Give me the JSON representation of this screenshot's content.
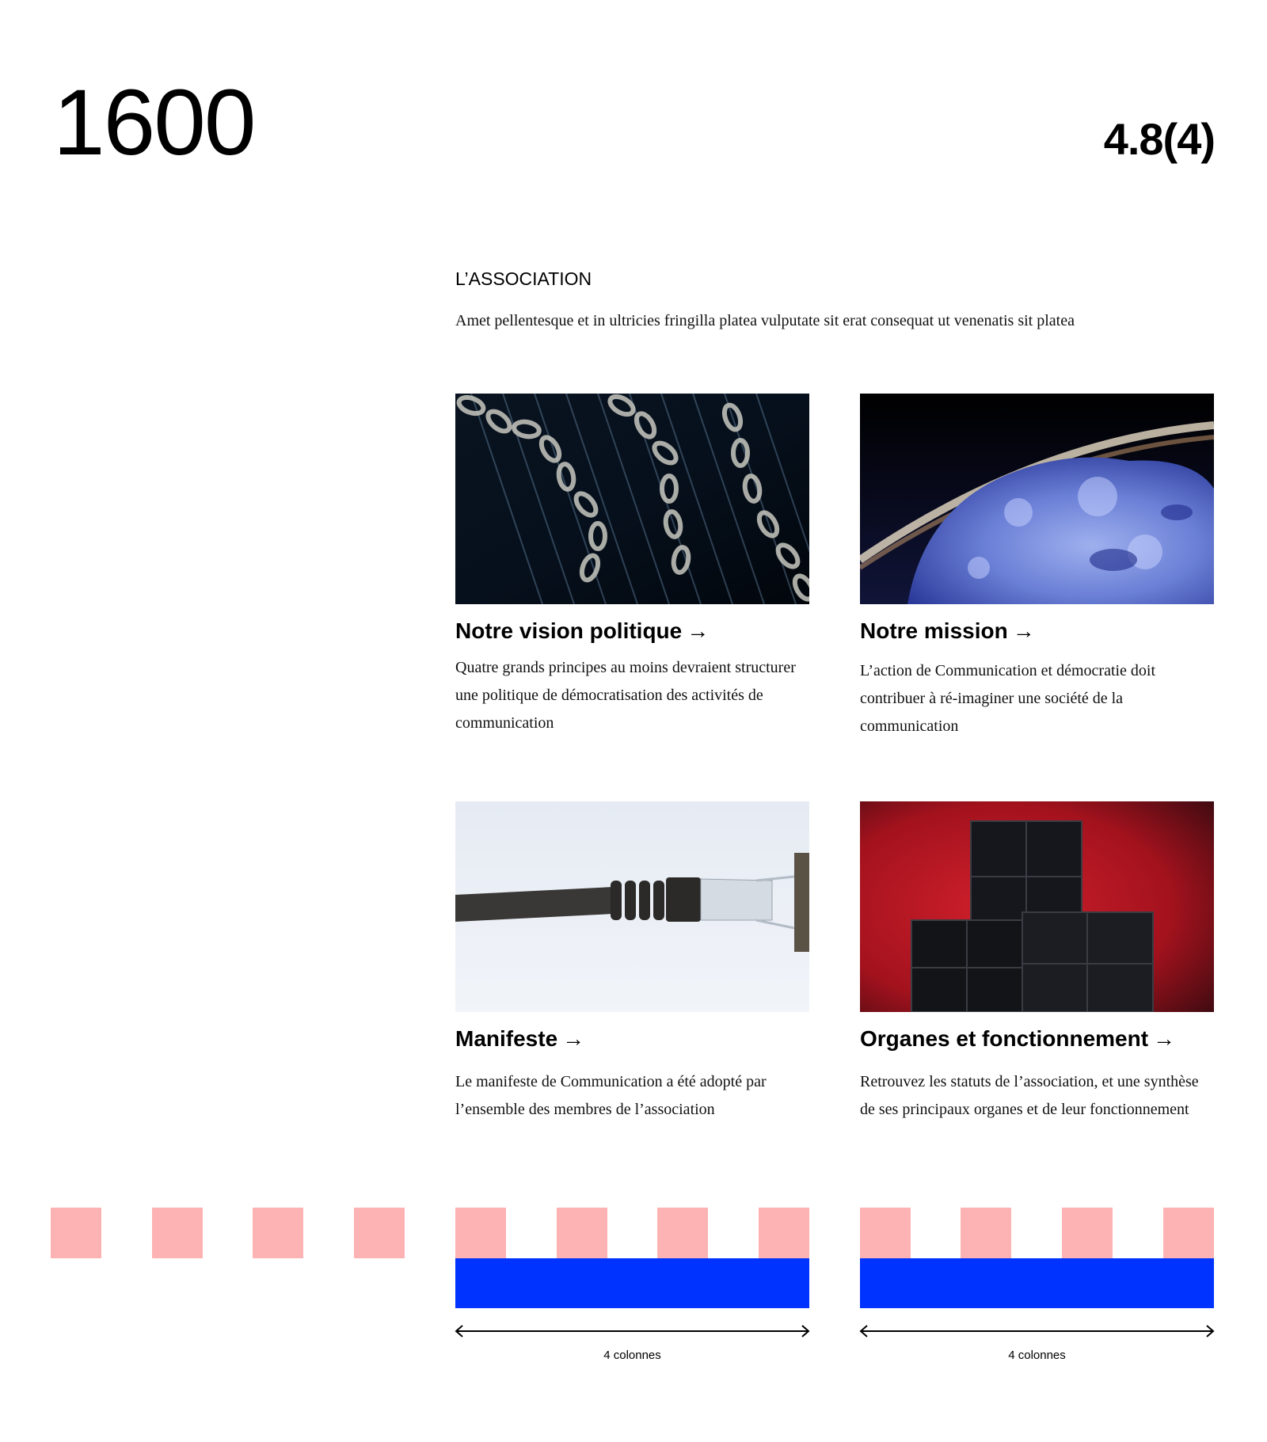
{
  "header": {
    "breakpoint_width": "1600",
    "ratio_label": "4.8(4)"
  },
  "section": {
    "title": "L’ASSOCIATION",
    "description": "Amet pellentesque et in ultricies fringilla platea vulputate sit erat consequat ut venenatis sit platea"
  },
  "cards": [
    {
      "title": "Notre vision politique",
      "arrow": "→",
      "text": "Quatre grands principes au moins devraient structurer une politique de démocratisation des activités de communication",
      "image": "chains-image"
    },
    {
      "title": "Notre mission",
      "arrow": "→",
      "text": "L’action de Communication et démocratie doit contribuer à ré-imaginer une société de la communication",
      "image": "ice-planet-image"
    },
    {
      "title": "Manifeste",
      "arrow": "→",
      "text": "Le manifeste de Communication a été adopté par l’ensemble des membres de  l’association",
      "image": "ethernet-cable-image"
    },
    {
      "title": "Organes et fonctionnement",
      "arrow": "→",
      "text": "Retrouvez les statuts de l’association, et une synthèse de ses principaux organes et de leur fonctionnement",
      "image": "black-cubes-image"
    }
  ],
  "grid_overlay": {
    "column_color": "#fdb3b3",
    "span_color": "#0033ff",
    "span_labels": [
      "4 colonnes",
      "4 colonnes"
    ]
  }
}
